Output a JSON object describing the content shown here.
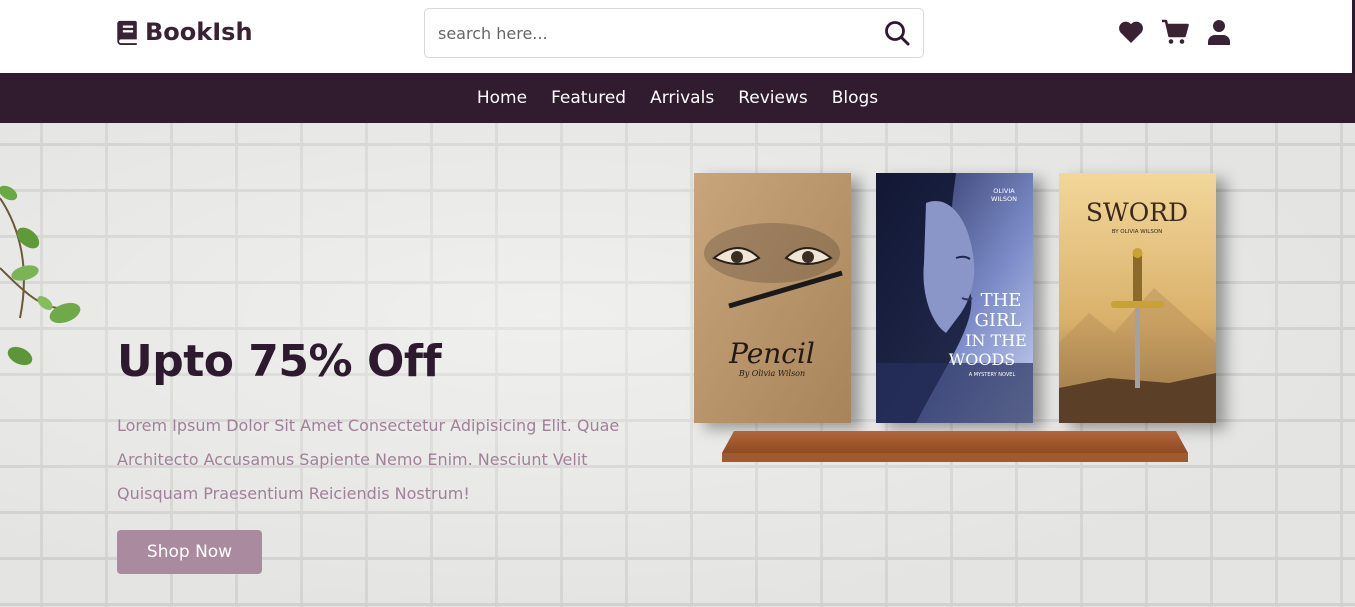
{
  "header": {
    "logo_text": "BookIsh",
    "search_placeholder": "search here...",
    "icons": [
      "heart-icon",
      "cart-icon",
      "user-icon"
    ]
  },
  "nav": {
    "items": [
      "Home",
      "Featured",
      "Arrivals",
      "Reviews",
      "Blogs"
    ]
  },
  "hero": {
    "headline": "Upto 75% Off",
    "description": "Lorem Ipsum Dolor Sit Amet Consectetur Adipisicing Elit. Quae Architecto Accusamus Sapiente Nemo Enim. Nesciunt Velit Quisquam Praesentium Reiciendis Nostrum!",
    "button_label": "Shop Now"
  },
  "books": [
    {
      "title": "Pencil",
      "author": "By Olivia Wilson"
    },
    {
      "title_lines": [
        "THE",
        "GIRL",
        "IN THE",
        "WOODS"
      ],
      "author_top": "OLIVIA",
      "author_bottom": "WILSON",
      "subtitle": "A MYSTERY NOVEL"
    },
    {
      "title": "SWORD",
      "author": "BY OLIVIA WILSON"
    }
  ],
  "colors": {
    "brand_dark": "#311b2f",
    "accent": "#a98a9f",
    "description_text": "#a1809a"
  }
}
